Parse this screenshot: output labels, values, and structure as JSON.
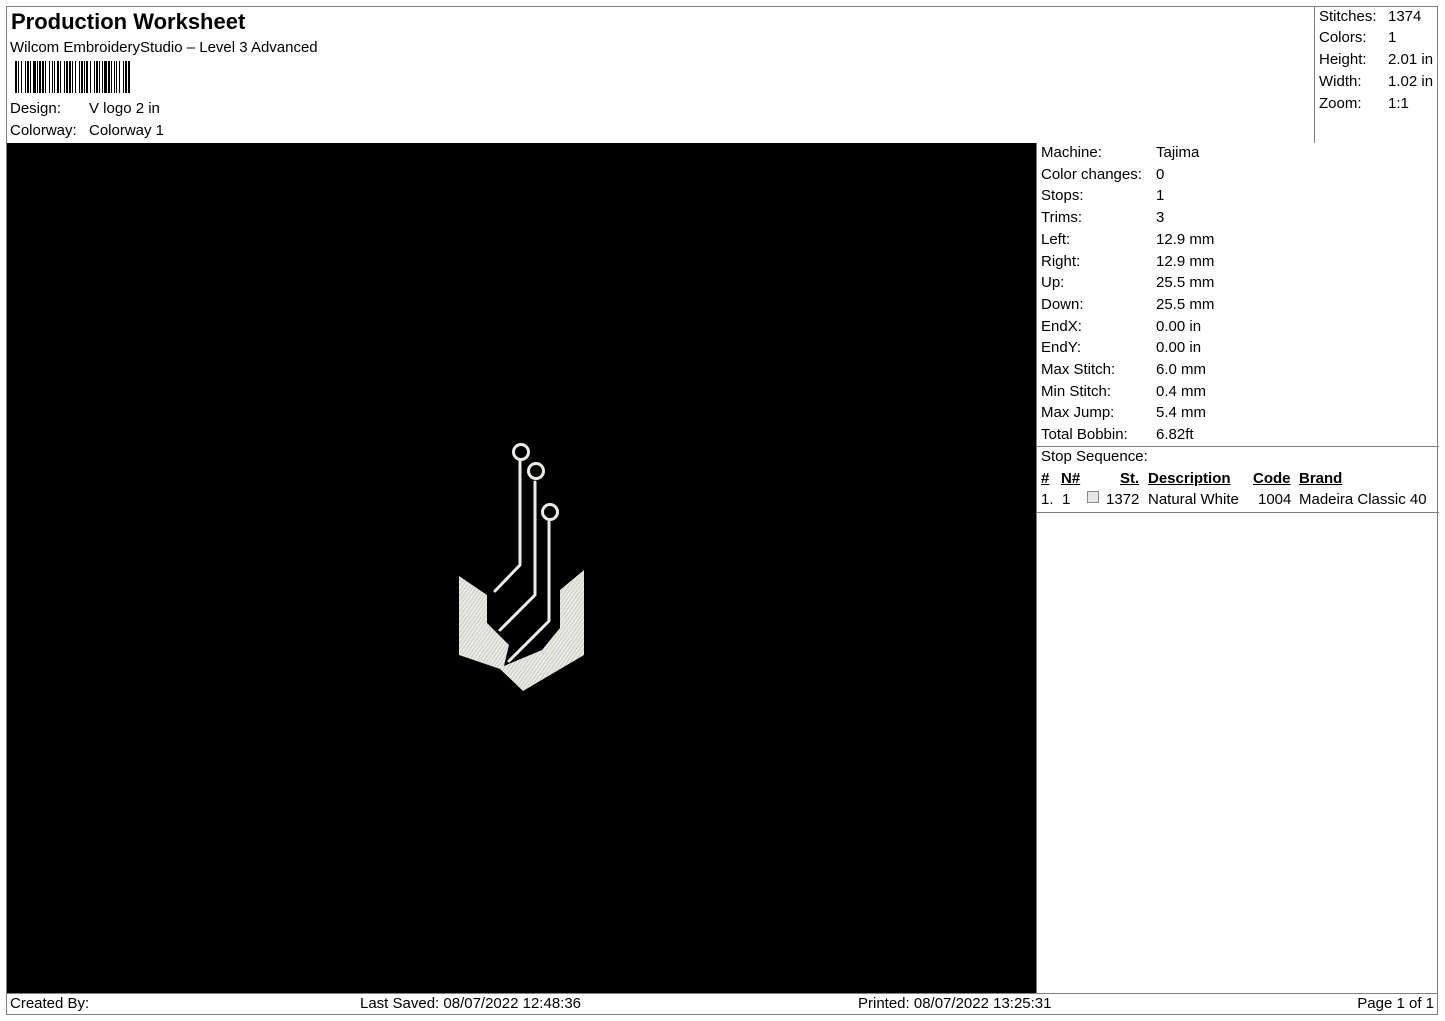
{
  "header": {
    "title": "Production Worksheet",
    "software": "Wilcom EmbroideryStudio – Level 3 Advanced",
    "design_label": "Design:",
    "design_value": "V logo 2 in",
    "colorway_label": "Colorway:",
    "colorway_value": "Colorway 1"
  },
  "summary": {
    "stitches_label": "Stitches:",
    "stitches_value": "1374",
    "colors_label": "Colors:",
    "colors_value": "1",
    "height_label": "Height:",
    "height_value": "2.01 in",
    "width_label": "Width:",
    "width_value": "1.02 in",
    "zoom_label": "Zoom:",
    "zoom_value": "1:1"
  },
  "machine_info": [
    {
      "label": "Machine:",
      "value": "Tajima"
    },
    {
      "label": "Color changes:",
      "value": "0"
    },
    {
      "label": "Stops:",
      "value": "1"
    },
    {
      "label": "Trims:",
      "value": "3"
    },
    {
      "label": "Left:",
      "value": "12.9 mm"
    },
    {
      "label": "Right:",
      "value": "12.9 mm"
    },
    {
      "label": "Up:",
      "value": "25.5 mm"
    },
    {
      "label": "Down:",
      "value": "25.5 mm"
    },
    {
      "label": "EndX:",
      "value": "0.00 in"
    },
    {
      "label": "EndY:",
      "value": "0.00 in"
    },
    {
      "label": "Max Stitch:",
      "value": "6.0 mm"
    },
    {
      "label": "Min Stitch:",
      "value": "0.4 mm"
    },
    {
      "label": "Max Jump:",
      "value": "5.4 mm"
    },
    {
      "label": "Total Bobbin:",
      "value": "6.82ft"
    }
  ],
  "stop_sequence": {
    "title": "Stop Sequence:",
    "headers": {
      "num": "#",
      "needle": "N#",
      "stitches": "St.",
      "description": "Description",
      "code": "Code",
      "brand": "Brand"
    },
    "rows": [
      {
        "num": "1.",
        "needle": "1",
        "swatch_color": "#e6e6e4",
        "stitches": "1372",
        "description": "Natural White",
        "code": "1004",
        "brand": "Madeira Classic 40"
      }
    ]
  },
  "preview": {
    "background": "#000000",
    "thread_color": "#ecece6"
  },
  "footer": {
    "created_by": "Created By:",
    "last_saved": "Last Saved: 08/07/2022 12:48:36",
    "printed": "Printed: 08/07/2022 13:25:31",
    "page": "Page 1 of 1"
  }
}
